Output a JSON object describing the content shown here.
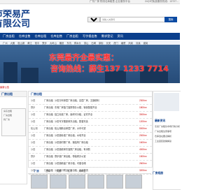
{
  "topbar": {
    "left_text": "广东厂房 物流仓库租售 企业服务平台",
    "right_text": "24小时免费服务热线：13727..."
  },
  "logo": {
    "line1": "莞市荣易产",
    "line2": "园有限公司"
  },
  "search": {
    "category": "请选择",
    "placeholder": "请输入关键词",
    "button": "搜索"
  },
  "nav": {
    "items": [
      "厂房出租",
      "仓库出售",
      "仓库出租",
      "仓库出售",
      "厂房出租",
      "写字楼出售",
      "需求登记",
      "资讯"
    ]
  },
  "subnav": {
    "items": [
      "广州",
      "大朗",
      "松山湖",
      "黄江",
      "常平",
      "寮步",
      "大岭山",
      "横沥",
      "东坑",
      "樟木头",
      "茶山",
      "石碣",
      "厚街",
      "长安",
      "虎门",
      "塘厦",
      "凤岗",
      "清溪",
      "谢岗"
    ]
  },
  "banner": {
    "headline": "东莞最齐全最实惠：",
    "hotline": "咨询热线：薛生137 1233 7714"
  },
  "notice": "最新公告",
  "left": {
    "header": "厂房出租",
    "box_lines": [
      "房东出租",
      "厂房出租",
      "找厂房"
    ]
  },
  "main": {
    "header": "厂房出租",
    "rows": [
      {
        "area": "沙田",
        "type": "厂房出租",
        "title": "沙田万科单层厂房出租，高层厂房，交通便利",
        "size": "2300m²"
      },
      {
        "area": "寮步",
        "type": "厂房出租",
        "title": "东莞厂房独门独院带办公楼，宿舍配套齐全",
        "size": "1800m²"
      },
      {
        "area": "沙田",
        "type": "厂房出租",
        "title": "独立标准厂房，面积可分租，证件齐全",
        "size": "3000m²"
      },
      {
        "area": "沙田",
        "type": "厂房出租",
        "title": "沙田写字楼原房东出租，配套完善",
        "size": "1200m²"
      },
      {
        "area": "松山湖",
        "type": "厂房出租",
        "title": "松山湖新出单层厂房，大车可进",
        "size": "5000m²"
      },
      {
        "area": "沙田",
        "type": "厂房出租",
        "title": "沙田镇标准厂房出租，水电齐全",
        "size": "2000m²"
      },
      {
        "area": "沙田",
        "type": "厂房出租",
        "title": "沙田镇村委厂房，钢结构厂房出租",
        "size": "1600m²"
      },
      {
        "area": "沙田",
        "type": "厂房出租",
        "title": "沙田镇原房东独院厂房出租，有消防",
        "size": "4000m²"
      },
      {
        "area": "寮步",
        "type": "厂房出租",
        "title": "寮步镇厂房出租，带装修办公室",
        "size": "1500m²"
      },
      {
        "area": "沙田",
        "type": "厂房出租",
        "title": "沙田镇新建厂房分租，可做仓储",
        "size": "2600m²"
      },
      {
        "area": "沙田",
        "type": "厂房出租",
        "title": "沙田港口附近厂房出租，适合物流",
        "size": "3200m²"
      }
    ]
  },
  "right": {
    "header": "最新资讯",
    "items": [
      "东莞厂房租赁市场行情分析",
      "厂房出租注意事项",
      "仓库选址要点解析",
      "工业园区政策解读"
    ]
  },
  "bottom": {
    "tabs": [
      "厂房",
      "仓库",
      "大朗",
      "常平",
      "大岭山"
    ],
    "active": 0,
    "gallery_header": "厂房相册"
  }
}
